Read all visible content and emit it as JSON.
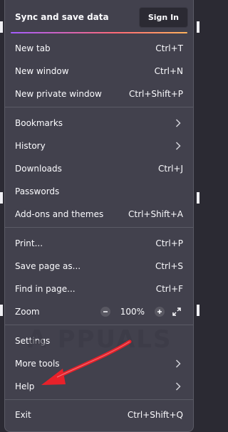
{
  "header": {
    "title": "Sync and save data",
    "signin_label": "Sign In"
  },
  "menu": {
    "new_tab": {
      "label": "New tab",
      "shortcut": "Ctrl+T"
    },
    "new_window": {
      "label": "New window",
      "shortcut": "Ctrl+N"
    },
    "new_private_window": {
      "label": "New private window",
      "shortcut": "Ctrl+Shift+P"
    },
    "bookmarks": {
      "label": "Bookmarks"
    },
    "history": {
      "label": "History"
    },
    "downloads": {
      "label": "Downloads",
      "shortcut": "Ctrl+J"
    },
    "passwords": {
      "label": "Passwords"
    },
    "addons": {
      "label": "Add-ons and themes",
      "shortcut": "Ctrl+Shift+A"
    },
    "print": {
      "label": "Print...",
      "shortcut": "Ctrl+P"
    },
    "save_page": {
      "label": "Save page as...",
      "shortcut": "Ctrl+S"
    },
    "find": {
      "label": "Find in page...",
      "shortcut": "Ctrl+F"
    },
    "zoom": {
      "label": "Zoom",
      "value": "100%",
      "minus": "−",
      "plus": "+"
    },
    "settings": {
      "label": "Settings"
    },
    "more_tools": {
      "label": "More tools"
    },
    "help": {
      "label": "Help"
    },
    "exit": {
      "label": "Exit",
      "shortcut": "Ctrl+Shift+Q"
    }
  },
  "watermark": {
    "text": "A PPUALS"
  },
  "colors": {
    "panel": "#42414d",
    "background": "#2b2a33",
    "annotation_arrow": "#e8212a"
  },
  "icons": {
    "submenu": "chevron-right-icon",
    "fullscreen": "expand-icon"
  }
}
